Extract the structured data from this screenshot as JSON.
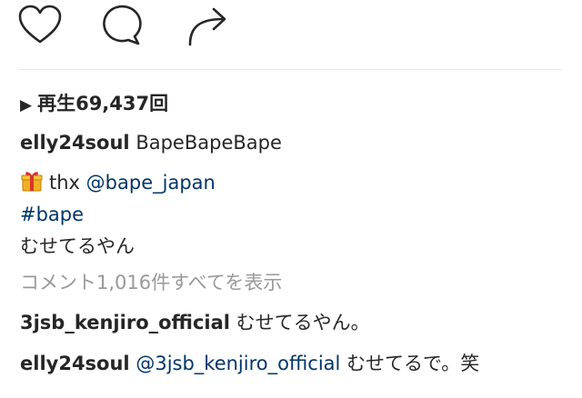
{
  "actions": {
    "like_icon": "heart-icon",
    "comment_icon": "comment-icon",
    "share_icon": "share-arrow-icon"
  },
  "post": {
    "views_prefix": "▶",
    "views_label": "再生69,437回",
    "caption": {
      "username": "elly24soul",
      "text": "BapeBapeBape",
      "gift_emoji": "gift-icon",
      "thanks": "thx",
      "mention": "@bape_japan",
      "hashtag": "#bape",
      "line3": "むせてるやん"
    },
    "view_all_comments": "コメント1,016件すべてを表示",
    "comments": [
      {
        "username": "3jsb_kenjiro_official",
        "text": "むせてるやん。"
      },
      {
        "username": "elly24soul",
        "mention": "@3jsb_kenjiro_official",
        "text": "むせてるで。笑"
      }
    ]
  },
  "colors": {
    "text": "#262626",
    "link": "#003569",
    "muted": "#999999"
  }
}
